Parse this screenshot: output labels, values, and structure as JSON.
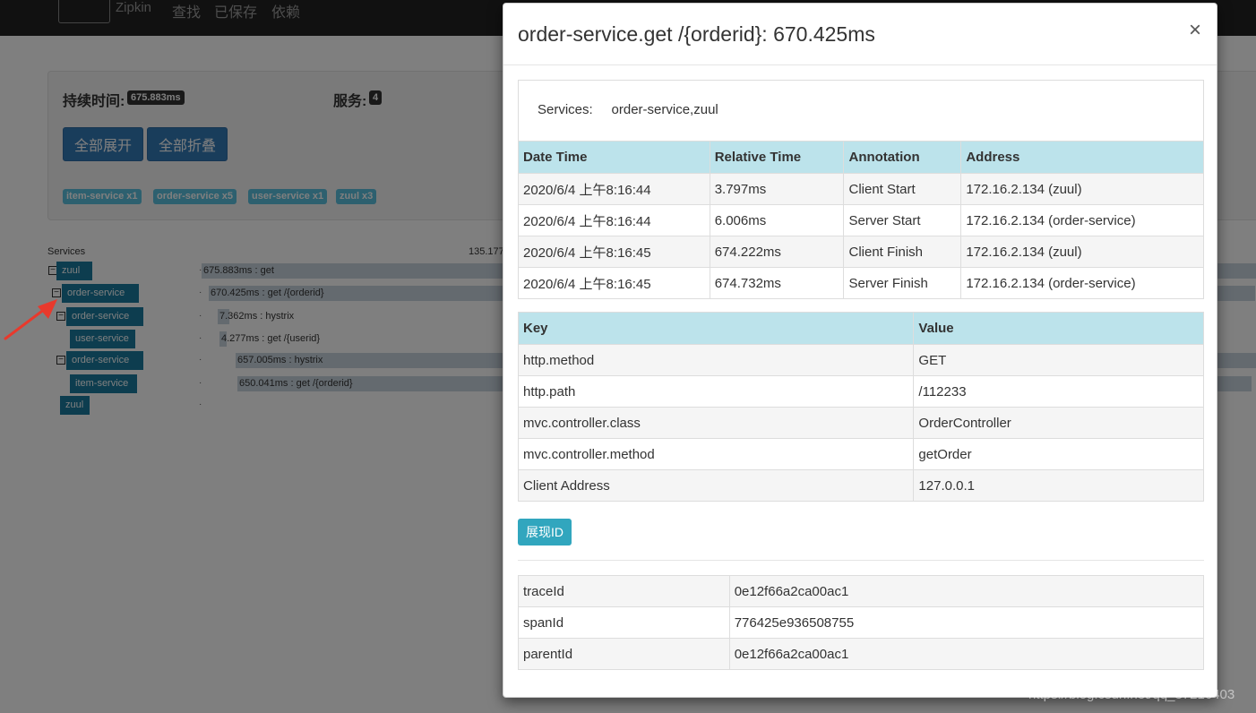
{
  "navbar": {
    "brand": "Zipkin",
    "links": [
      "查找",
      "已保存",
      "依赖"
    ]
  },
  "summary": {
    "duration_label": "持续时间:",
    "duration_value": "675.883ms",
    "services_label": "服务:",
    "services_value": "4",
    "expand_all": "全部展开",
    "collapse_all": "全部折叠",
    "service_tags": [
      "item-service x1",
      "order-service x5",
      "user-service x1",
      "zuul x3"
    ]
  },
  "trace": {
    "header": "Services",
    "scale_tick": "135.177",
    "toggle_glyph": "⊟",
    "dot_glyph": "·",
    "rows": [
      {
        "service": "zuul",
        "label": "675.883ms : get",
        "fill": 1.0
      },
      {
        "service": "order-service",
        "label": "670.425ms : get /{orderid}",
        "fill": 0.992
      },
      {
        "service": "order-service",
        "label": "7.362ms : hystrix",
        "fill": 0.011
      },
      {
        "service": "user-service",
        "label": "4.277ms : get /{userid}",
        "fill": 0.006
      },
      {
        "service": "order-service",
        "label": "657.005ms : hystrix",
        "fill": 0.972
      },
      {
        "service": "item-service",
        "label": "650.041ms : get /{orderid}",
        "fill": 0.962
      },
      {
        "service": "zuul",
        "label": "",
        "fill": 0.0
      }
    ]
  },
  "modal": {
    "title": "order-service.get /{orderid}: 670.425ms",
    "close": "×",
    "services_label": "Services:",
    "services_value": "order-service,zuul",
    "annotations": {
      "headers": [
        "Date Time",
        "Relative Time",
        "Annotation",
        "Address"
      ],
      "rows": [
        [
          "2020/6/4 上午8:16:44",
          "3.797ms",
          "Client Start",
          "172.16.2.134 (zuul)"
        ],
        [
          "2020/6/4 上午8:16:44",
          "6.006ms",
          "Server Start",
          "172.16.2.134 (order-service)"
        ],
        [
          "2020/6/4 上午8:16:45",
          "674.222ms",
          "Client Finish",
          "172.16.2.134 (zuul)"
        ],
        [
          "2020/6/4 上午8:16:45",
          "674.732ms",
          "Server Finish",
          "172.16.2.134 (order-service)"
        ]
      ]
    },
    "tags": {
      "headers": [
        "Key",
        "Value"
      ],
      "rows": [
        [
          "http.method",
          "GET"
        ],
        [
          "http.path",
          "/112233"
        ],
        [
          "mvc.controller.class",
          "OrderController"
        ],
        [
          "mvc.controller.method",
          "getOrder"
        ],
        [
          "Client Address",
          "127.0.0.1"
        ]
      ]
    },
    "show_ids_button": "展现ID",
    "ids": {
      "rows": [
        [
          "traceId",
          "0e12f66a2ca00ac1"
        ],
        [
          "spanId",
          "776425e936508755"
        ],
        [
          "parentId",
          "0e12f66a2ca00ac1"
        ]
      ]
    }
  },
  "watermark": "https://blog.csdn.net/qq_37216403",
  "colors": {
    "service_chip": "#1a7b9e",
    "table_header": "#bce3eb",
    "primary_button": "#337ab7",
    "info_button": "#31a6be",
    "arrow": "#e8392c"
  }
}
